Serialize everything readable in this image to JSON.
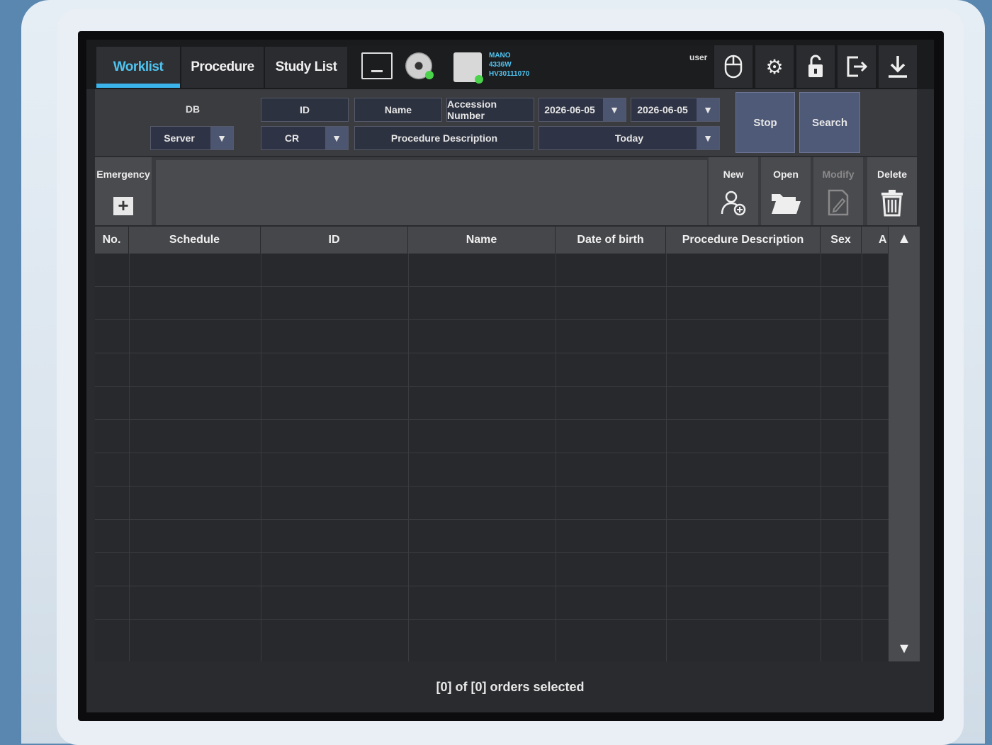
{
  "tabs": [
    {
      "label": "Worklist",
      "active": true
    },
    {
      "label": "Procedure",
      "active": false
    },
    {
      "label": "Study List",
      "active": false
    }
  ],
  "status": {
    "detector_lines": [
      "MANO",
      "4336W",
      "HV30111070"
    ],
    "user": "user"
  },
  "toolbar_icons": [
    "mouse-icon",
    "settings-icon",
    "unlock-icon",
    "logout-icon",
    "download-icon"
  ],
  "search": {
    "db_label": "DB",
    "db_value": "Server",
    "id_label": "ID",
    "modality_value": "CR",
    "name_label": "Name",
    "accession_label": "Accession Number",
    "procedure_label": "Procedure Description",
    "date_from": "2026-06-05",
    "date_to": "2026-06-05",
    "date_range": "Today",
    "stop_label": "Stop",
    "search_label": "Search",
    "dropdown_glyph": "▼"
  },
  "actions": {
    "emergency": "Emergency",
    "new": "New",
    "open": "Open",
    "modify": "Modify",
    "delete": "Delete"
  },
  "table": {
    "columns": [
      "No.",
      "Schedule",
      "ID",
      "Name",
      "Date of birth",
      "Procedure Description",
      "Sex",
      "A"
    ],
    "rows": []
  },
  "status_bar": "[0] of [0] orders selected",
  "colors": {
    "accent": "#3ab4ea",
    "panel": "#3b3c40",
    "field": "#2e3345",
    "button": "#4f5a78"
  }
}
